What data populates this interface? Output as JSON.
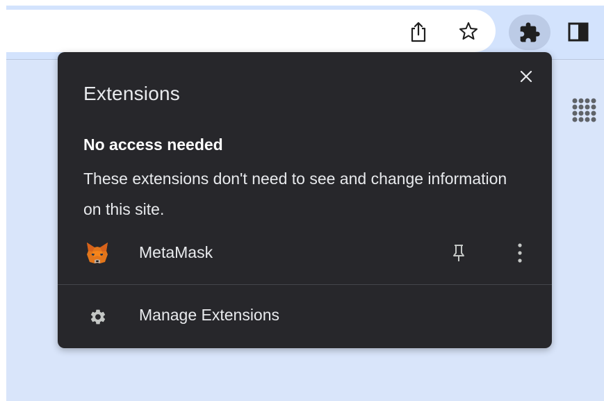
{
  "toolbar": {
    "share_icon": "share-icon",
    "bookmark_icon": "star-icon",
    "extensions_icon": "puzzle-icon",
    "side_panel_icon": "side-panel-icon",
    "apps_icon": "apps-grid-icon"
  },
  "popup": {
    "title": "Extensions",
    "close_icon": "close-icon",
    "section_heading": "No access needed",
    "section_description": "These extensions don't need to see and change information on this site.",
    "extensions": [
      {
        "name": "MetaMask",
        "icon": "metamask-fox-icon",
        "pin_icon": "pin-icon",
        "more_icon": "more-vert-icon"
      }
    ],
    "manage_label": "Manage Extensions",
    "manage_icon": "gear-icon"
  },
  "colors": {
    "popup_background": "#27272b",
    "page_background": "#d9e5fa",
    "toolbar_background": "#d3e3fd",
    "active_button": "#bccbe6"
  }
}
